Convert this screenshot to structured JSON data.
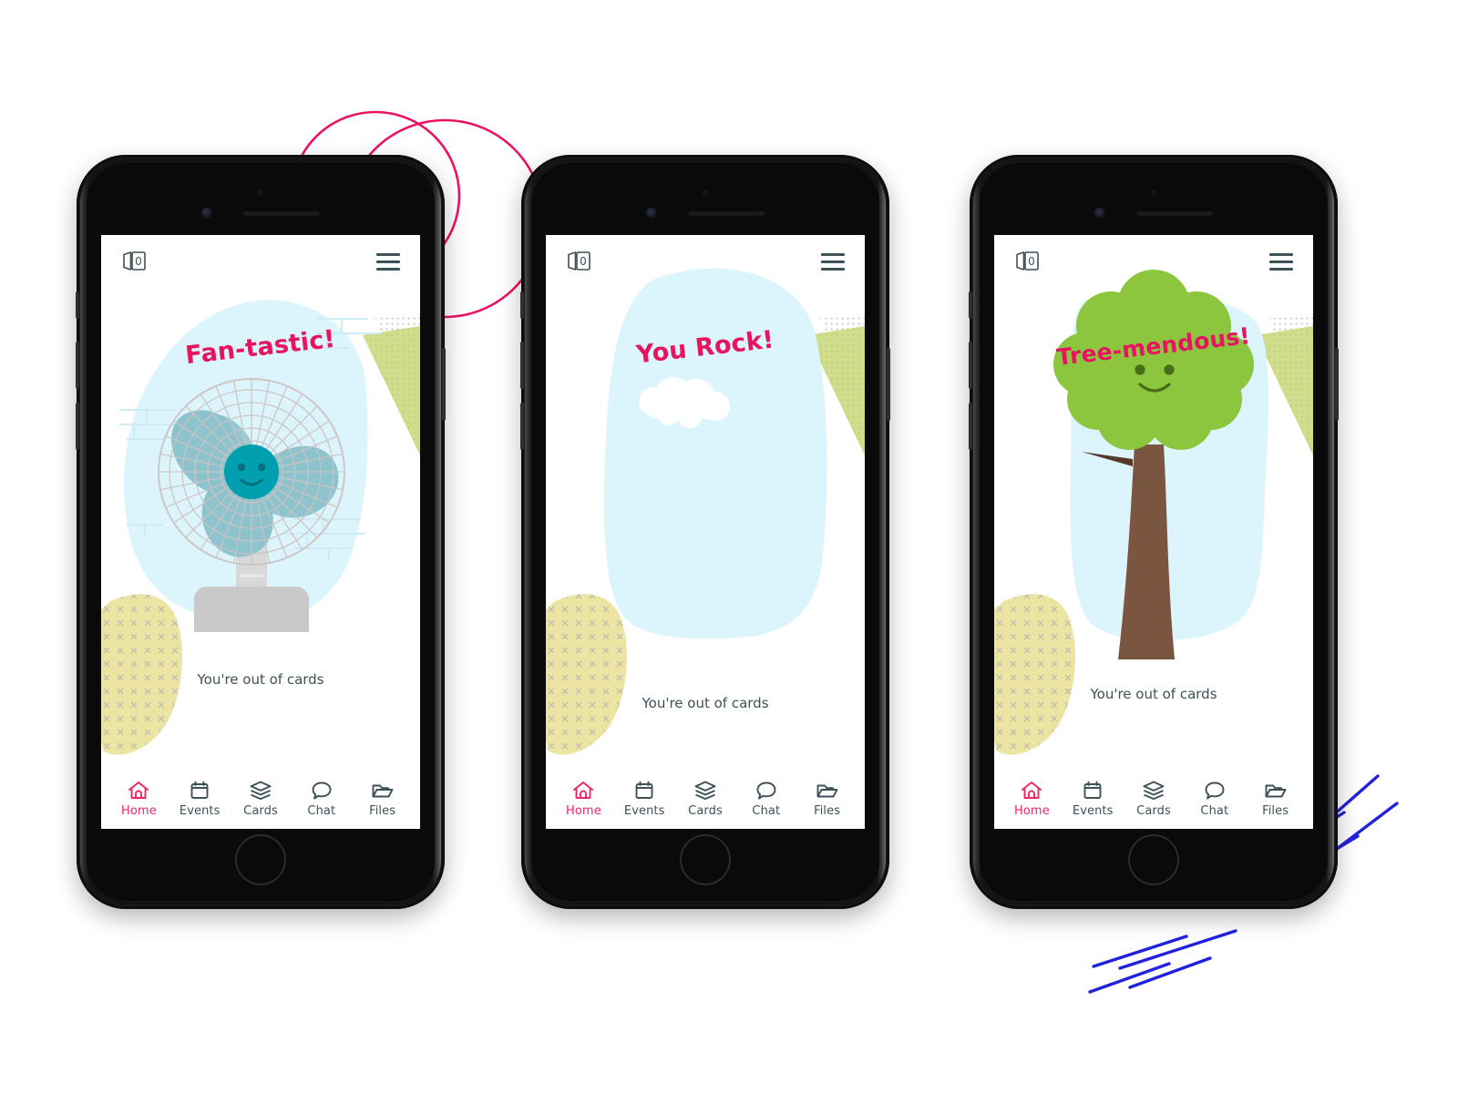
{
  "theme": {
    "pink": "#ef2567",
    "title_pink": "#e8145f",
    "slate": "#3d5159",
    "blob_blue": "#d9f3f9",
    "blob_yellow": "#ece4a2",
    "triangle_green": "#cfdd8c",
    "triangle_gray": "#d8d8d8",
    "fan_teal": "#8cc3cd",
    "fan_hub": "#009fb0",
    "tree_green": "#8cc63f",
    "tree_trunk": "#7a5640",
    "deco_blue": "#2222dd",
    "phone_body": "#1c1c1c"
  },
  "phones": [
    {
      "id": "phone-1",
      "topbar": {
        "card_count": "0",
        "card_icon": "cards-stack-icon",
        "menu_icon": "hamburger-menu-icon"
      },
      "title": "Fan-tastic!",
      "illustration": "fan-illustration",
      "caption": "You're out of cards",
      "tabs": [
        {
          "label": "Home",
          "icon": "home-icon",
          "active": true
        },
        {
          "label": "Events",
          "icon": "calendar-icon",
          "active": false
        },
        {
          "label": "Cards",
          "icon": "layers-icon",
          "active": false
        },
        {
          "label": "Chat",
          "icon": "speech-bubble-icon",
          "active": false
        },
        {
          "label": "Files",
          "icon": "folder-icon",
          "active": false
        }
      ]
    },
    {
      "id": "phone-2",
      "topbar": {
        "card_count": "0",
        "card_icon": "cards-stack-icon",
        "menu_icon": "hamburger-menu-icon"
      },
      "title": "You Rock!",
      "illustration": "sky-cloud-illustration",
      "caption": "You're out of cards",
      "tabs": [
        {
          "label": "Home",
          "icon": "home-icon",
          "active": true
        },
        {
          "label": "Events",
          "icon": "calendar-icon",
          "active": false
        },
        {
          "label": "Cards",
          "icon": "layers-icon",
          "active": false
        },
        {
          "label": "Chat",
          "icon": "speech-bubble-icon",
          "active": false
        },
        {
          "label": "Files",
          "icon": "folder-icon",
          "active": false
        }
      ]
    },
    {
      "id": "phone-3",
      "topbar": {
        "card_count": "0",
        "card_icon": "cards-stack-icon",
        "menu_icon": "hamburger-menu-icon"
      },
      "title": "Tree-mendous!",
      "illustration": "tree-illustration",
      "caption": "You're out of cards",
      "tabs": [
        {
          "label": "Home",
          "icon": "home-icon",
          "active": true
        },
        {
          "label": "Events",
          "icon": "calendar-icon",
          "active": false
        },
        {
          "label": "Cards",
          "icon": "layers-icon",
          "active": false
        },
        {
          "label": "Chat",
          "icon": "speech-bubble-icon",
          "active": false
        },
        {
          "label": "Files",
          "icon": "folder-icon",
          "active": false
        }
      ]
    }
  ],
  "decorations": {
    "pink_circles": "two-overlapping-pink-circle-outlines",
    "blue_strokes": "blue-diagonal-stroke-group"
  }
}
